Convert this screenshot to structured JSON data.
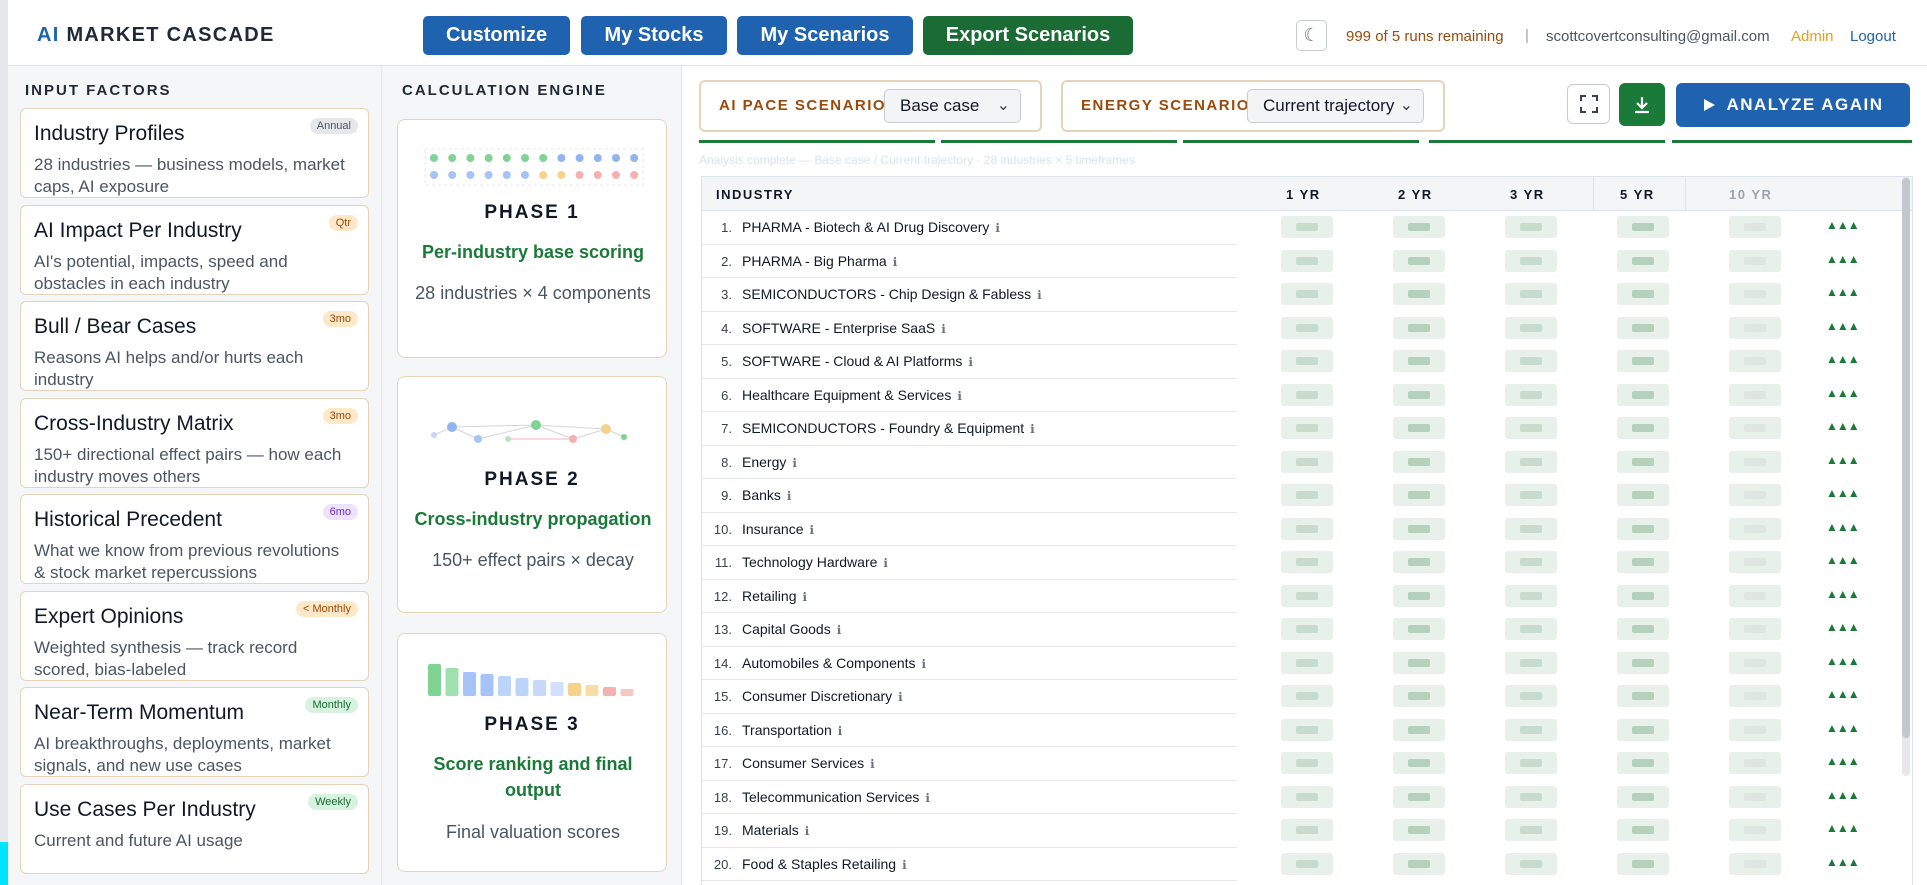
{
  "header": {
    "logo_ai": "AI",
    "logo_rest": "MARKET CASCADE",
    "nav": [
      "Customize",
      "My Stocks",
      "My Scenarios",
      "Export Scenarios"
    ],
    "theme_icon": "moon-icon",
    "runs_remaining": "999 of 5 runs remaining",
    "separator": "|",
    "email": "scottcovertconsulting@gmail.com",
    "admin": "Admin",
    "logout": "Logout"
  },
  "input_factors": {
    "title": "INPUT FACTORS",
    "items": [
      {
        "title": "Industry Profiles",
        "badge": "Annual",
        "desc": "28 industries — business models, market caps, AI exposure"
      },
      {
        "title": "AI Impact Per Industry",
        "badge": "Qtr",
        "desc": "AI's potential, impacts, speed and obstacles in each industry"
      },
      {
        "title": "Bull / Bear Cases",
        "badge": "3mo",
        "desc": "Reasons AI helps and/or hurts each industry"
      },
      {
        "title": "Cross-Industry Matrix",
        "badge": "3mo",
        "desc": "150+ directional effect pairs — how each industry moves others"
      },
      {
        "title": "Historical Precedent",
        "badge": "6mo",
        "desc": "What we know from previous revolutions & stock market repercussions"
      },
      {
        "title": "Expert Opinions",
        "badge": "< Monthly",
        "desc": "Weighted synthesis — track record scored, bias-labeled"
      },
      {
        "title": "Near-Term Momentum",
        "badge": "Monthly",
        "desc": "AI breakthroughs, deployments, market signals, and new use cases"
      },
      {
        "title": "Use Cases Per Industry",
        "badge": "Weekly",
        "desc": "Current and future AI usage"
      }
    ]
  },
  "engine": {
    "title": "CALCULATION ENGINE",
    "phases": [
      {
        "title": "PHASE 1",
        "subtitle": "Per-industry base scoring",
        "desc": "28 industries × 4 components"
      },
      {
        "title": "PHASE 2",
        "subtitle": "Cross-industry propagation",
        "desc": "150+ effect pairs × decay"
      },
      {
        "title": "PHASE 3",
        "subtitle": "Score ranking and final output",
        "desc": "Final valuation scores"
      }
    ]
  },
  "controls": {
    "ai_pace_label": "AI PACE SCENARIO",
    "ai_pace_value": "Base case",
    "energy_label": "ENERGY SCENARIO",
    "energy_value": "Current trajectory",
    "expand_icon": "expand-icon",
    "download_icon": "download-icon",
    "analyze_label": "ANALYZE AGAIN",
    "status": "Analysis complete — Base case / Current trajectory · 28 industries × 5 timeframes"
  },
  "table": {
    "headers": [
      "INDUSTRY",
      "1 YR",
      "2 YR",
      "3 YR",
      "5 YR",
      "10 YR"
    ],
    "trend_glyph": "▲▲▲",
    "rows": [
      {
        "num": "1.",
        "name": "PHARMA - Biotech & AI Drug Discovery"
      },
      {
        "num": "2.",
        "name": "PHARMA - Big Pharma"
      },
      {
        "num": "3.",
        "name": "SEMICONDUCTORS - Chip Design & Fabless"
      },
      {
        "num": "4.",
        "name": "SOFTWARE - Enterprise SaaS"
      },
      {
        "num": "5.",
        "name": "SOFTWARE - Cloud & AI Platforms"
      },
      {
        "num": "6.",
        "name": "Healthcare Equipment & Services"
      },
      {
        "num": "7.",
        "name": "SEMICONDUCTORS - Foundry & Equipment"
      },
      {
        "num": "8.",
        "name": "Energy"
      },
      {
        "num": "9.",
        "name": "Banks"
      },
      {
        "num": "10.",
        "name": "Insurance"
      },
      {
        "num": "11.",
        "name": "Technology Hardware"
      },
      {
        "num": "12.",
        "name": "Retailing"
      },
      {
        "num": "13.",
        "name": "Capital Goods"
      },
      {
        "num": "14.",
        "name": "Automobiles & Components"
      },
      {
        "num": "15.",
        "name": "Consumer Discretionary"
      },
      {
        "num": "16.",
        "name": "Transportation"
      },
      {
        "num": "17.",
        "name": "Consumer Services"
      },
      {
        "num": "18.",
        "name": "Telecommunication Services"
      },
      {
        "num": "19.",
        "name": "Materials"
      },
      {
        "num": "20.",
        "name": "Food & Staples Retailing"
      }
    ]
  },
  "colors": {
    "brand_blue": "#1f63b0",
    "brand_green": "#1a6b34",
    "accent_orange": "#9a4a0b"
  }
}
